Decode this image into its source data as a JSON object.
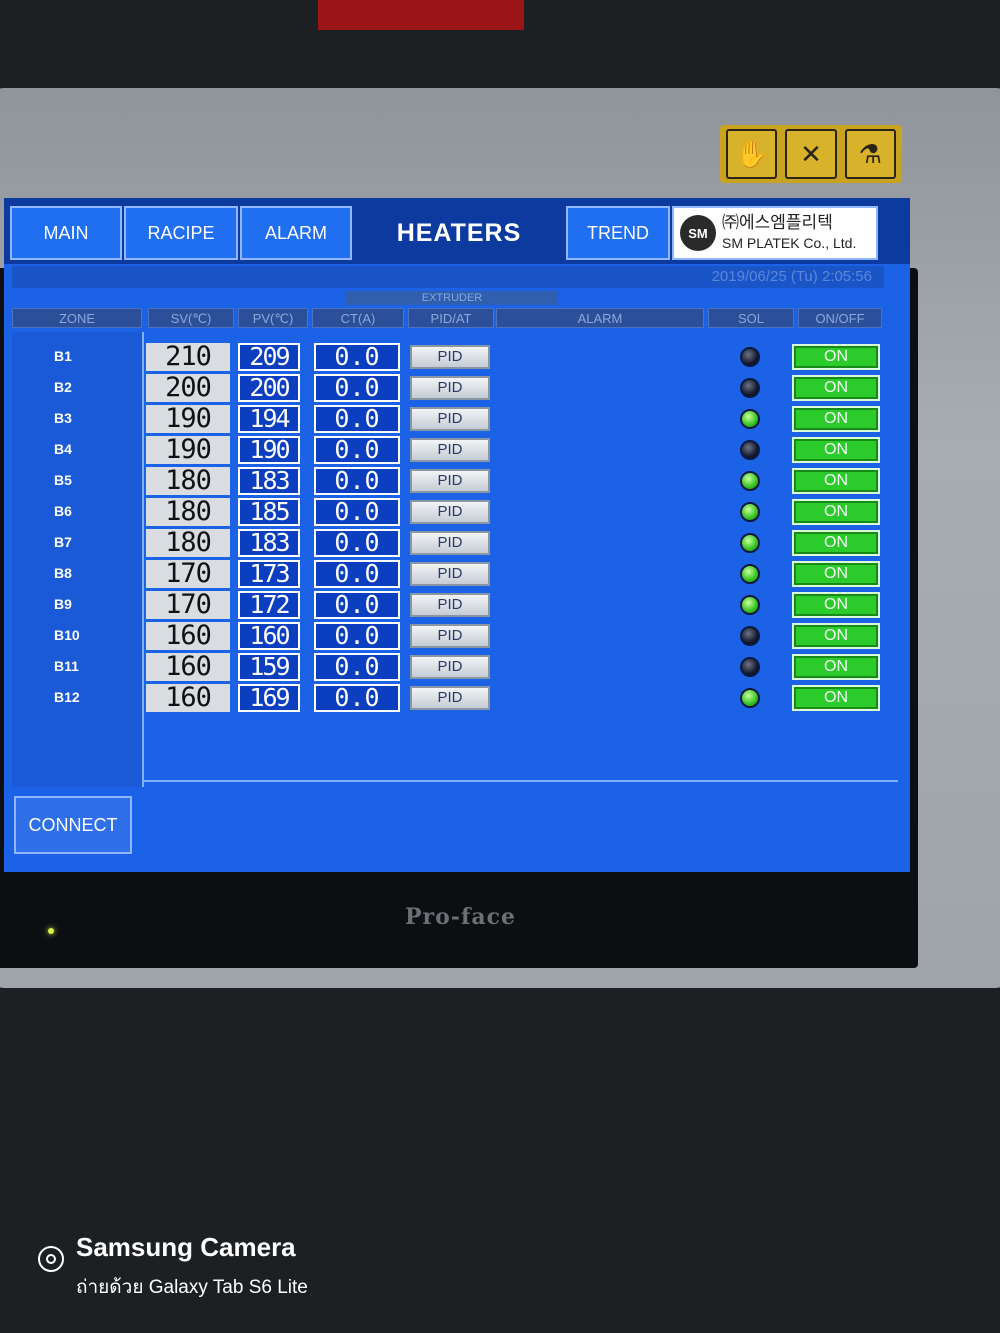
{
  "device": {
    "brand": "Pro-face"
  },
  "nav": {
    "main": "MAIN",
    "recipe": "RACIPE",
    "alarm": "ALARM",
    "title": "HEATERS",
    "trend": "TREND"
  },
  "company": {
    "logo_text": "SM",
    "name_kr": "㈜에스엠플리텍",
    "name_en": "SM PLATEK Co., Ltd."
  },
  "datetime_text": "2019/06/25 (Tu) 2:05:56",
  "section_title": "EXTRUDER",
  "columns": {
    "zone": "ZONE",
    "sv": "SV(℃)",
    "pv": "PV(℃)",
    "ct": "CT(A)",
    "pid_at": "PID/AT",
    "alarm": "ALARM",
    "sol": "SOL",
    "onoff": "ON/OFF"
  },
  "rows": [
    {
      "zone": "B1",
      "sv": "210",
      "pv": "209",
      "ct": "0.0",
      "pid": "PID",
      "sol": "off",
      "onoff": "ON"
    },
    {
      "zone": "B2",
      "sv": "200",
      "pv": "200",
      "ct": "0.0",
      "pid": "PID",
      "sol": "off",
      "onoff": "ON"
    },
    {
      "zone": "B3",
      "sv": "190",
      "pv": "194",
      "ct": "0.0",
      "pid": "PID",
      "sol": "on",
      "onoff": "ON"
    },
    {
      "zone": "B4",
      "sv": "190",
      "pv": "190",
      "ct": "0.0",
      "pid": "PID",
      "sol": "off",
      "onoff": "ON"
    },
    {
      "zone": "B5",
      "sv": "180",
      "pv": "183",
      "ct": "0.0",
      "pid": "PID",
      "sol": "on",
      "onoff": "ON"
    },
    {
      "zone": "B6",
      "sv": "180",
      "pv": "185",
      "ct": "0.0",
      "pid": "PID",
      "sol": "on",
      "onoff": "ON"
    },
    {
      "zone": "B7",
      "sv": "180",
      "pv": "183",
      "ct": "0.0",
      "pid": "PID",
      "sol": "on",
      "onoff": "ON"
    },
    {
      "zone": "B8",
      "sv": "170",
      "pv": "173",
      "ct": "0.0",
      "pid": "PID",
      "sol": "on",
      "onoff": "ON"
    },
    {
      "zone": "B9",
      "sv": "170",
      "pv": "172",
      "ct": "0.0",
      "pid": "PID",
      "sol": "on",
      "onoff": "ON"
    },
    {
      "zone": "B10",
      "sv": "160",
      "pv": "160",
      "ct": "0.0",
      "pid": "PID",
      "sol": "off",
      "onoff": "ON"
    },
    {
      "zone": "B11",
      "sv": "160",
      "pv": "159",
      "ct": "0.0",
      "pid": "PID",
      "sol": "off",
      "onoff": "ON"
    },
    {
      "zone": "B12",
      "sv": "160",
      "pv": "169",
      "ct": "0.0",
      "pid": "PID",
      "sol": "on",
      "onoff": "ON"
    }
  ],
  "connect_label": "CONNECT",
  "watermark": {
    "title": "Samsung Camera",
    "subtitle": "ถ่ายด้วย Galaxy Tab S6 Lite"
  }
}
